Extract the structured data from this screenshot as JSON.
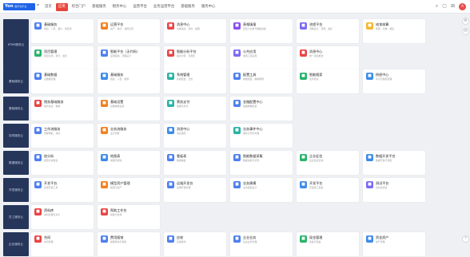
{
  "header": {
    "logo_text": "Yon",
    "logo_sub": "数字化平台",
    "nav_items": [
      "首页",
      "应用",
      "综合门户",
      "基础服务",
      "税务中心",
      "运营平台",
      "业务运营平台",
      "基础服务",
      "服务中心"
    ],
    "active_index": 1
  },
  "sections": [
    {
      "label": "KTMS服务云",
      "rows": [
        [
          {
            "title": "基础服务",
            "desc": "组织、人员、客户、供应商",
            "color": "#4d7ff0",
            "icon": "grid-icon"
          },
          {
            "title": "运营平台",
            "desc": "资产、统计、消费记录",
            "color": "#f2801e",
            "icon": "chart-icon"
          },
          {
            "title": "消息中心",
            "desc": "系统消息、待办、提醒",
            "color": "#e84545",
            "icon": "bell-icon"
          },
          {
            "title": "表格填报",
            "desc": "自定义表单与数据采集",
            "color": "#8a4df0",
            "icon": "doc-icon"
          },
          {
            "title": "流程平台",
            "desc": "流程设计、流转、监控",
            "color": "#7a6af2",
            "icon": "flow-icon"
          },
          {
            "title": "成本核算",
            "desc": "核算、分摊、报表",
            "color": "#f5b82e",
            "icon": "coin-icon"
          }
        ],
        [
          {
            "title": "项目管理",
            "desc": "项目立项、执行、监控",
            "color": "#29b36a",
            "icon": "folder-icon"
          },
          {
            "title": "智能平台（无代码）",
            "desc": "应用搭建、流程设计",
            "color": "#4d7ff0",
            "icon": "cube-icon"
          },
          {
            "title": "智能分析平台",
            "desc": "报表分析、可视化",
            "color": "#e84545",
            "icon": "analysis-icon"
          },
          {
            "title": "公共应用",
            "desc": "通用工具应用",
            "color": "#7a6af2",
            "icon": "app-icon"
          },
          {
            "title": "消息中心",
            "desc": "统一消息推送",
            "color": "#e84545",
            "icon": "mail-icon"
          }
        ]
      ]
    },
    {
      "label": "基础服务云",
      "rows": [
        [
          {
            "title": "基础数据",
            "desc": "主数据管理",
            "color": "#4d7ff0",
            "icon": "db-icon"
          },
          {
            "title": "基础服务",
            "desc": "组织、人员、权限",
            "color": "#3d8be8",
            "icon": "user-icon"
          },
          {
            "title": "系统管理",
            "desc": "系统配置、日志",
            "color": "#29b3a4",
            "icon": "setting-icon"
          },
          {
            "title": "配置工具",
            "desc": "参数配置、编码规则",
            "color": "#4d7ff0",
            "icon": "sliders-icon"
          },
          {
            "title": "智能搜索",
            "desc": "全局检索",
            "color": "#29b36a",
            "icon": "search-icon"
          },
          {
            "title": "授权中心",
            "desc": "许可与授权管理",
            "color": "#3d8be8",
            "icon": "key-icon"
          }
        ]
      ]
    },
    {
      "label": "基础服务云",
      "rows": [
        [
          {
            "title": "税务基础服务",
            "desc": "税务信息、税种",
            "color": "#e84545",
            "icon": "tax-icon"
          },
          {
            "title": "基础设置",
            "desc": "基础参数设置",
            "color": "#f2801e",
            "icon": "gear-icon"
          },
          {
            "title": "票务支付",
            "desc": "票据与支付",
            "color": "#29b3a4",
            "icon": "pay-icon"
          },
          {
            "title": "金融配置中心",
            "desc": "金融参数配置",
            "color": "#4d7ff0",
            "icon": "bank-icon"
          }
        ]
      ]
    },
    {
      "label": "协同服务云",
      "rows": [
        [
          {
            "title": "工作流服务",
            "desc": "流程审批、待办",
            "color": "#4d7ff0",
            "icon": "workflow-icon"
          },
          {
            "title": "业务流服务",
            "desc": "业务流转",
            "color": "#f2801e",
            "icon": "biz-icon"
          },
          {
            "title": "消息中心",
            "desc": "消息通知",
            "color": "#3d8be8",
            "icon": "bell-icon"
          },
          {
            "title": "业务事件中心",
            "desc": "事件订阅与处理",
            "color": "#29b3a4",
            "icon": "event-icon"
          }
        ]
      ]
    },
    {
      "label": "数据服务云",
      "rows": [
        [
          {
            "title": "经分析",
            "desc": "经营分析报表",
            "color": "#4d7ff0",
            "icon": "pie-icon"
          },
          {
            "title": "地图表",
            "desc": "地图可视化",
            "color": "#3d8be8",
            "icon": "map-icon"
          },
          {
            "title": "看板表",
            "desc": "数据看板",
            "color": "#4d7ff0",
            "icon": "board-icon"
          },
          {
            "title": "智能数据采集",
            "desc": "数据采集与清洗",
            "color": "#4d7ff0",
            "icon": "collect-icon"
          },
          {
            "title": "企业征信",
            "desc": "企业信息查询",
            "color": "#29b36a",
            "icon": "shield-icon"
          },
          {
            "title": "数据开发平台",
            "desc": "数据开发与调度",
            "color": "#3d8be8",
            "icon": "code-icon"
          }
        ]
      ]
    },
    {
      "label": "开发服务云",
      "rows": [
        [
          {
            "title": "开发平台",
            "desc": "应用开发工具",
            "color": "#4d7ff0",
            "icon": "dev-icon"
          },
          {
            "title": "模型资产管理",
            "desc": "模型与资产",
            "color": "#f2801e",
            "icon": "model-icon"
          },
          {
            "title": "运维开发台",
            "desc": "运维开发管理",
            "color": "#4d7ff0",
            "icon": "ops-icon"
          },
          {
            "title": "业务建模",
            "desc": "业务模型设计",
            "color": "#4d7ff0",
            "icon": "build-icon"
          },
          {
            "title": "开发平台",
            "desc": "开发者工具集",
            "color": "#3d8be8",
            "icon": "tool-icon"
          },
          {
            "title": "测试平台",
            "desc": "自动化测试",
            "color": "#7a6af2",
            "icon": "test-icon"
          }
        ]
      ]
    },
    {
      "label": "员工服务云",
      "rows": [
        [
          {
            "title": "资料库",
            "desc": "资料管理与共享",
            "color": "#e84545",
            "icon": "book-icon"
          },
          {
            "title": "帮助工作台",
            "desc": "帮助与支持",
            "color": "#e84545",
            "icon": "help-icon"
          }
        ]
      ]
    },
    {
      "label": "企业服务云",
      "rows": [
        [
          {
            "title": "合同",
            "desc": "合同管理",
            "color": "#e84545",
            "icon": "contract-icon"
          },
          {
            "title": "费用报销",
            "desc": "报销申请与审批",
            "color": "#4d7ff0",
            "icon": "expense-icon"
          },
          {
            "title": "应收",
            "desc": "应收账款",
            "color": "#4d7ff0",
            "icon": "receive-icon"
          },
          {
            "title": "企业业务",
            "desc": "企业业务处理",
            "color": "#4d7ff0",
            "icon": "biz2-icon"
          },
          {
            "title": "现金管理",
            "desc": "资金与现金",
            "color": "#29b36a",
            "icon": "cash-icon"
          },
          {
            "title": "资金资产",
            "desc": "资产管理",
            "color": "#3d8be8",
            "icon": "asset-icon"
          }
        ]
      ]
    }
  ]
}
